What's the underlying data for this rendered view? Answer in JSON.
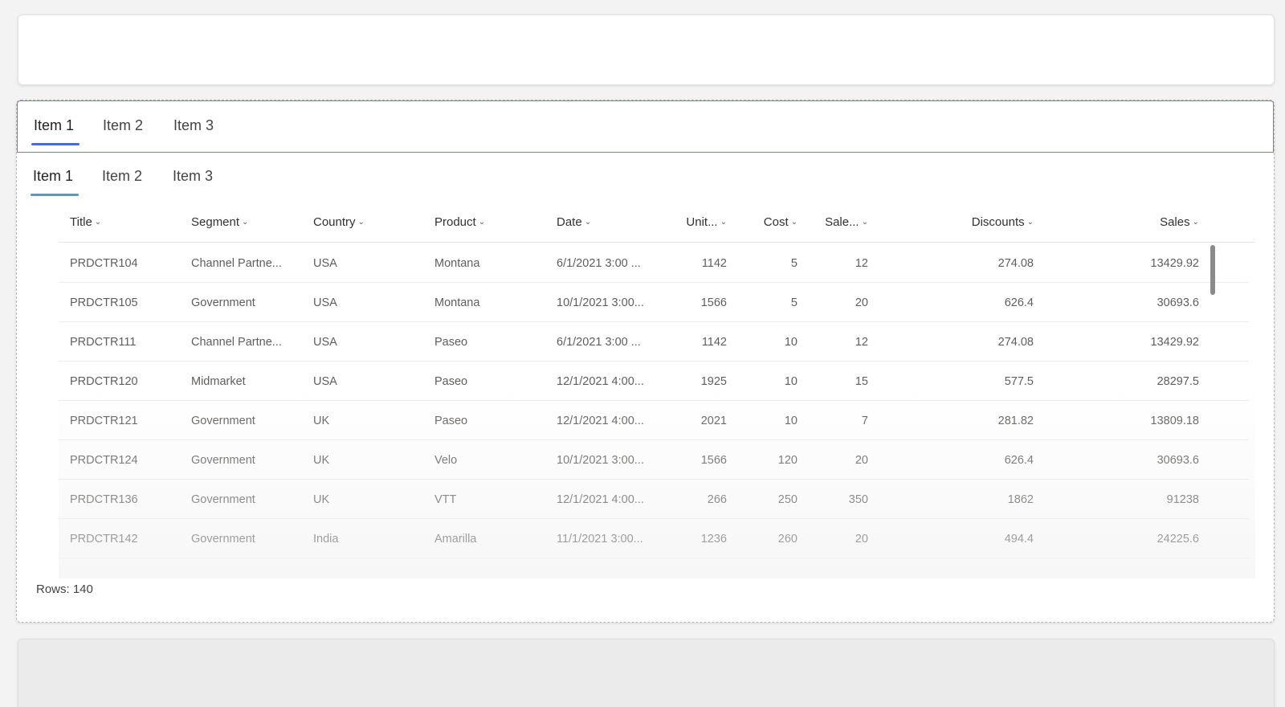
{
  "colors": {
    "accent_outer": "#4a6cc8",
    "accent_inner": "#4a9fc9",
    "frame": "#9b6ea8"
  },
  "tabs_outer": {
    "items": [
      "Item 1",
      "Item 2",
      "Item 3"
    ],
    "selected": 0
  },
  "tabs_inner": {
    "items": [
      "Item 1",
      "Item 2",
      "Item 3"
    ],
    "selected": 0
  },
  "table": {
    "columns": [
      {
        "label": "Title",
        "icon": "chevron-down-icon"
      },
      {
        "label": "Segment",
        "icon": "chevron-down-icon"
      },
      {
        "label": "Country",
        "icon": "chevron-down-icon"
      },
      {
        "label": "Product",
        "icon": "chevron-down-icon"
      },
      {
        "label": "Date",
        "icon": "chevron-down-icon"
      },
      {
        "label": "Unit...",
        "icon": "chevron-down-icon"
      },
      {
        "label": "Cost",
        "icon": "chevron-down-icon"
      },
      {
        "label": "Sale...",
        "icon": "chevron-down-icon"
      },
      {
        "label": "Discounts",
        "icon": "chevron-down-icon"
      },
      {
        "label": "Sales",
        "icon": "chevron-down-icon"
      }
    ],
    "rows": [
      [
        "PRDCTR104",
        "Channel Partne...",
        "USA",
        "Montana",
        "6/1/2021 3:00 ...",
        "1142",
        "5",
        "12",
        "274.08",
        "13429.92"
      ],
      [
        "PRDCTR105",
        "Government",
        "USA",
        "Montana",
        "10/1/2021 3:00...",
        "1566",
        "5",
        "20",
        "626.4",
        "30693.6"
      ],
      [
        "PRDCTR111",
        "Channel Partne...",
        "USA",
        "Paseo",
        "6/1/2021 3:00 ...",
        "1142",
        "10",
        "12",
        "274.08",
        "13429.92"
      ],
      [
        "PRDCTR120",
        "Midmarket",
        "USA",
        "Paseo",
        "12/1/2021 4:00...",
        "1925",
        "10",
        "15",
        "577.5",
        "28297.5"
      ],
      [
        "PRDCTR121",
        "Government",
        "UK",
        "Paseo",
        "12/1/2021 4:00...",
        "2021",
        "10",
        "7",
        "281.82",
        "13809.18"
      ],
      [
        "PRDCTR124",
        "Government",
        "UK",
        "Velo",
        "10/1/2021 3:00...",
        "1566",
        "120",
        "20",
        "626.4",
        "30693.6"
      ],
      [
        "PRDCTR136",
        "Government",
        "UK",
        "VTT",
        "12/1/2021 4:00...",
        "266",
        "250",
        "350",
        "1862",
        "91238"
      ],
      [
        "PRDCTR142",
        "Government",
        "India",
        "Amarilla",
        "11/1/2021 3:00...",
        "1236",
        "260",
        "20",
        "494.4",
        "24225.6"
      ]
    ],
    "footer": "Rows: 140"
  }
}
